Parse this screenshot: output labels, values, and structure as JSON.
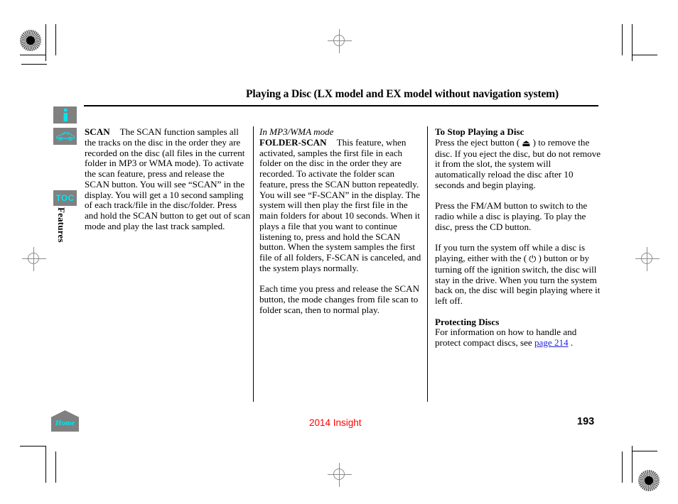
{
  "header": {
    "title": "Playing a Disc (LX model and EX model without navigation system)"
  },
  "sidebar": {
    "info_icon": "info-icon",
    "vehicle_icon": "car-icon",
    "toc_label": "TOC",
    "section_label": "Features",
    "home_label": "Home"
  },
  "columns": {
    "left": {
      "heading": "SCAN",
      "body": "The SCAN function samples all the tracks on the disc in the order they are recorded on the disc (all files in the current folder in MP3 or WMA mode). To activate the scan feature, press and release the SCAN button. You will see “SCAN” in the display. You will get a 10 second sampling of each track/file in the disc/folder. Press and hold the SCAN button to get out of scan mode and play the last track sampled."
    },
    "middle": {
      "mode_note": "In MP3/WMA mode",
      "heading": "FOLDER-SCAN",
      "body": "This feature, when activated, samples the first file in each folder on the disc in the order they are recorded. To activate the folder scan feature, press the SCAN button repeatedly. You will see “F-SCAN” in the display. The system will then play the first file in the main folders for about 10 seconds. When it plays a file that you want to continue listening to, press and hold the SCAN button. When the system samples the first file of all folders, F-SCAN is canceled, and the system plays normally.",
      "body2": "Each time you press and release the SCAN button, the mode changes from file scan to folder scan, then to normal play."
    },
    "right": {
      "heading1": "To Stop Playing a Disc",
      "para1_a": "Press the eject button (",
      "eject_symbol": "⏏",
      "para1_b": ") to remove the disc. If you eject the disc, but do not remove it from the slot, the system will automatically reload the disc after 10 seconds and begin playing.",
      "para2": "Press the FM/AM button to switch to the radio while a disc is playing. To play the disc, press the CD button.",
      "para3_a": "If you turn the system off while a disc is playing, either with the (",
      "power_symbol": "⏻",
      "para3_b": ") button or by turning off the ignition switch, the disc will stay in the drive. When you turn the system back on, the disc will begin playing where it left off.",
      "heading2": "Protecting Discs",
      "para4": "For information on how to handle and protect compact discs, see ",
      "link_text": "page 214",
      "para4_end": " ."
    }
  },
  "footer": {
    "model": "2014 Insight",
    "page_number": "193"
  },
  "colors": {
    "accent_cyan": "#00e5ee",
    "link_blue": "#2222dd",
    "footer_red": "#ff0000",
    "icon_bg_gray": "#808080"
  }
}
